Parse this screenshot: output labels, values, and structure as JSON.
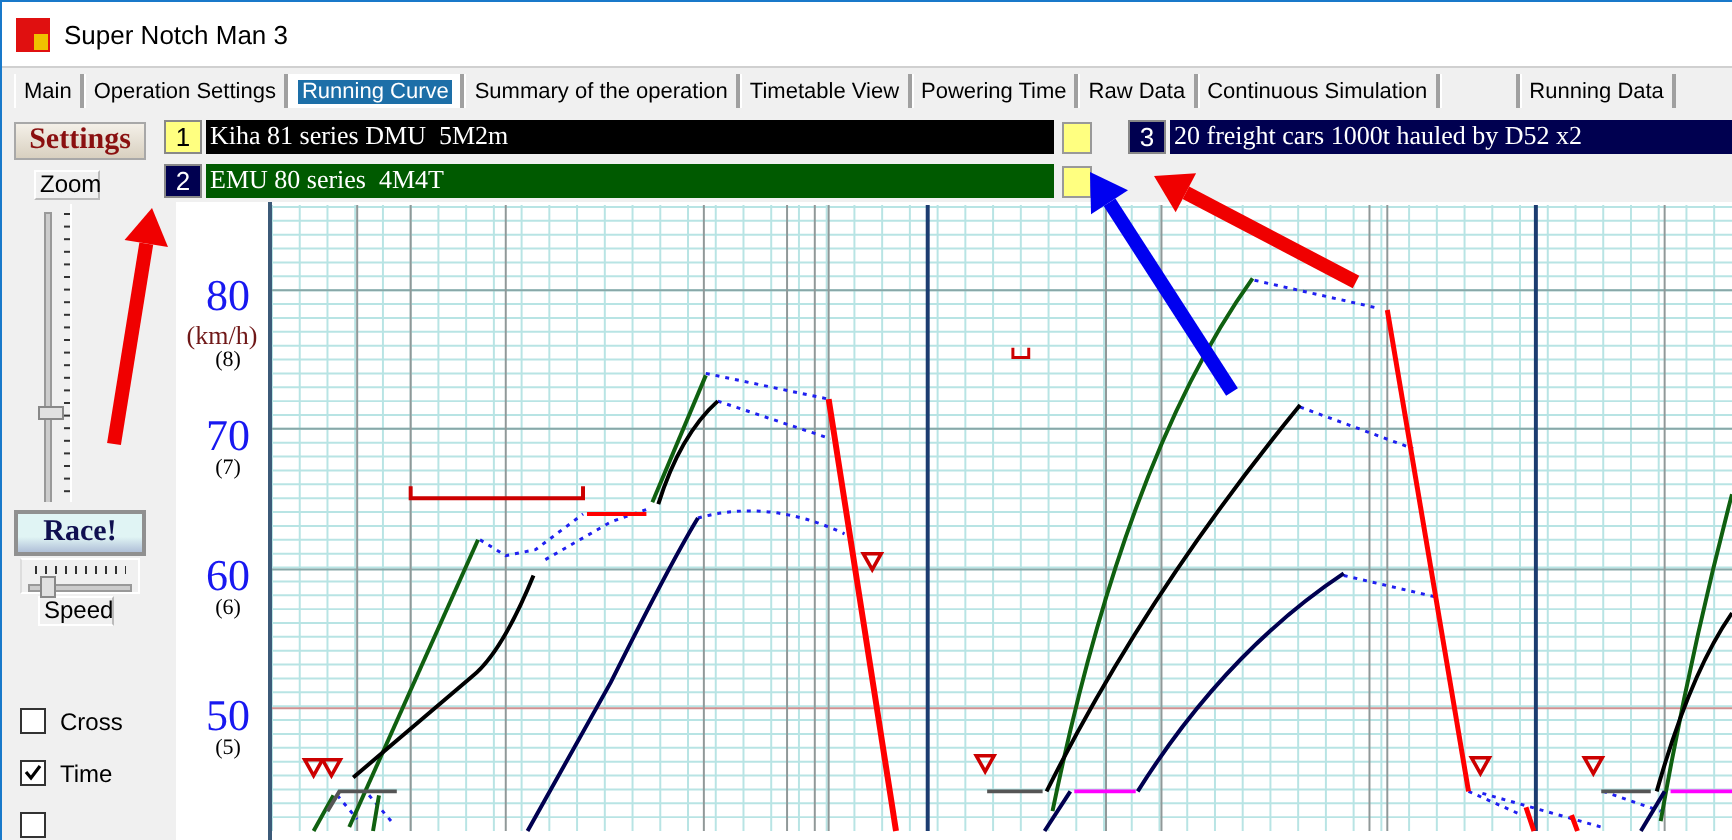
{
  "window": {
    "title": "Super Notch Man 3"
  },
  "tabs": [
    {
      "label": "Main",
      "selected": false
    },
    {
      "label": "Operation Settings",
      "selected": false
    },
    {
      "label": "Running Curve",
      "selected": true
    },
    {
      "label": "Summary of the operation",
      "selected": false
    },
    {
      "label": "Timetable View",
      "selected": false
    },
    {
      "label": "Powering Time",
      "selected": false
    },
    {
      "label": "Raw Data",
      "selected": false
    },
    {
      "label": "Continuous Simulation",
      "selected": false
    },
    {
      "selected": false
    },
    {
      "label": "Running Data",
      "selected": false
    }
  ],
  "controls": {
    "settings_button": "Settings",
    "zoom_label": "Zoom",
    "zoom_slider": {
      "level": 0.35
    },
    "race_button": "Race!",
    "speed_slider": {
      "level": 0.2
    },
    "speed_label": "Speed"
  },
  "trains": [
    {
      "number": "1",
      "name": "Kiha 81 series DMU  5M2m",
      "selected": true,
      "color": "#000000",
      "swatch": true
    },
    {
      "number": "2",
      "name": "EMU 80 series  4M4T",
      "selected": false,
      "color": "#005a00",
      "swatch": true
    },
    {
      "number": "3",
      "name": "20 freight cars 1000t hauled by D52 x2",
      "selected": false,
      "color": "#000050",
      "swatch": false
    }
  ],
  "checkboxes": [
    {
      "label": "Cross",
      "checked": false
    },
    {
      "label": "Time",
      "checked": true
    },
    {
      "checked": false
    }
  ],
  "chart": {
    "y_unit": "(km/h)",
    "y_labels": [
      {
        "value": "80",
        "notch": "(8)"
      },
      {
        "value": "70",
        "notch": "(7)"
      },
      {
        "value": "60",
        "notch": "(6)"
      },
      {
        "value": "50",
        "notch": "(5)"
      }
    ]
  }
}
